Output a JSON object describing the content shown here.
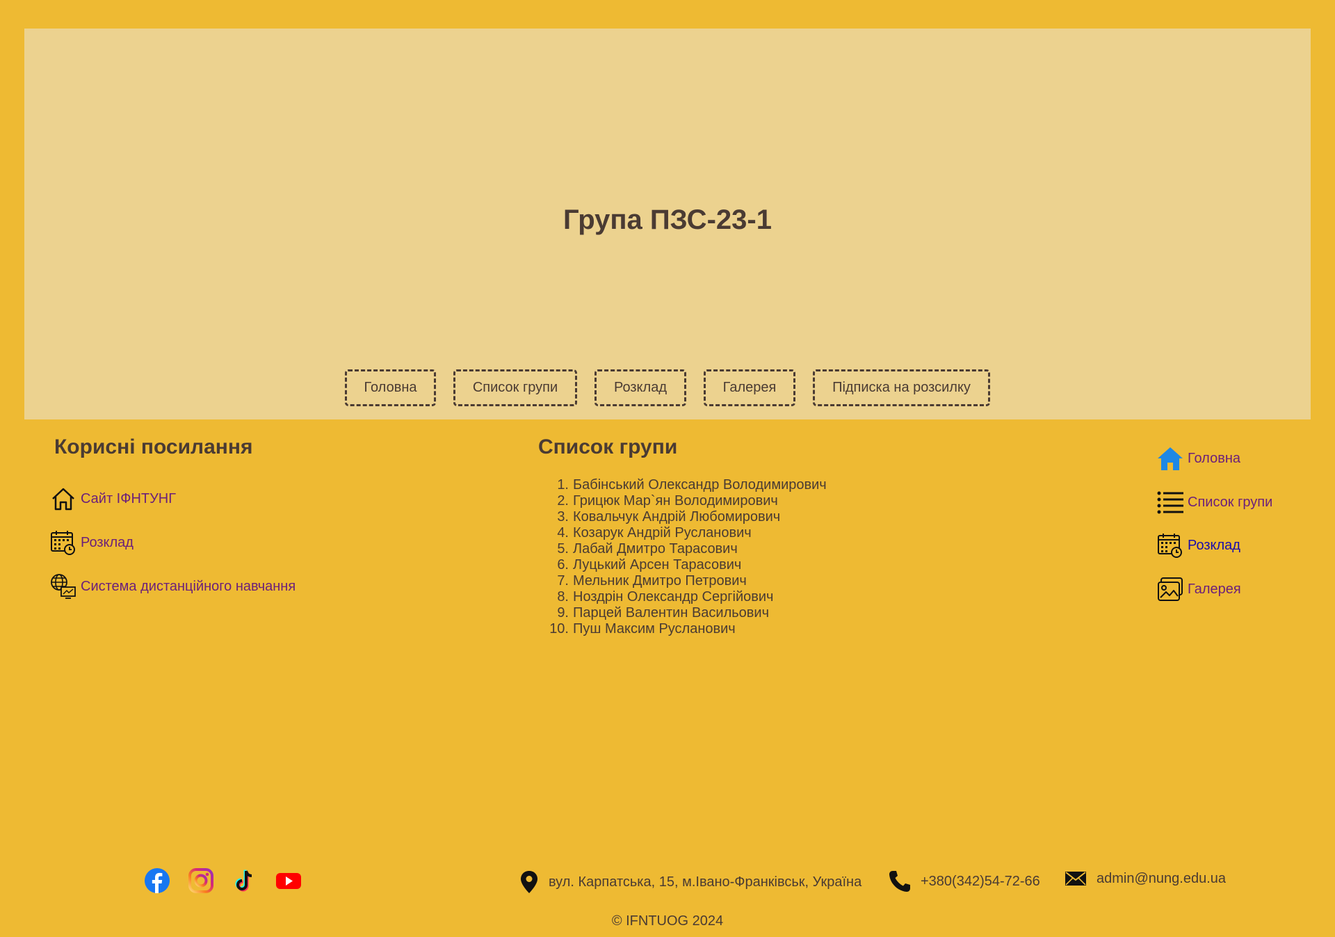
{
  "header": {
    "title": "Група ПЗС-23-1",
    "nav": [
      "Головна",
      "Список групи",
      "Розклад",
      "Галерея",
      "Підписка на розсилку"
    ]
  },
  "useful_links": {
    "title": "Корисні посилання",
    "items": [
      {
        "label": "Сайт ІФНТУНГ",
        "icon": "home-outline-icon"
      },
      {
        "label": "Розклад",
        "icon": "calendar-clock-icon"
      },
      {
        "label": "Система дистанційного навчання",
        "icon": "globe-monitor-icon"
      }
    ]
  },
  "group_list": {
    "title": "Список групи",
    "students": [
      "Бабінський Олександр Володимирович",
      "Грицюк Мар`ян Володимирович",
      "Ковальчук Андрій Любомирович",
      "Козарук Андрій Русланович",
      "Лабай Дмитро Тарасович",
      "Луцький Арсен Тарасович",
      "Мельник Дмитро Петрович",
      "Ноздрін Олександр Сергійович",
      "Парцей Валентин Васильович",
      "Пуш Максим Русланович"
    ]
  },
  "side_nav": {
    "items": [
      {
        "label": "Головна",
        "icon": "home-filled-icon"
      },
      {
        "label": "Список групи",
        "icon": "list-icon"
      },
      {
        "label": "Розклад",
        "icon": "calendar-clock-icon"
      },
      {
        "label": "Галерея",
        "icon": "gallery-icon"
      }
    ]
  },
  "footer": {
    "social": [
      "facebook-icon",
      "instagram-icon",
      "tiktok-icon",
      "youtube-icon"
    ],
    "address": "вул. Карпатська, 15, м.Івано-Франківськ, Україна",
    "phone": "+380(342)54-72-66",
    "email": "admin@nung.edu.ua",
    "copyright": "© IFNTUOG 2024"
  },
  "colors": {
    "background": "#eeba33",
    "header": "#ecd28f",
    "text": "#4a3b33",
    "link": "#6b1f7a",
    "link_active": "#1a0dab"
  }
}
